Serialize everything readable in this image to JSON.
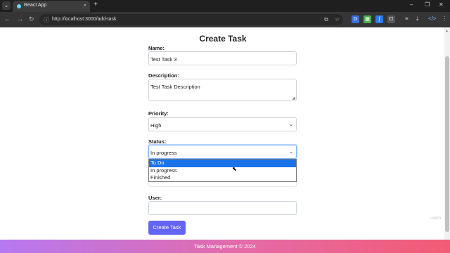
{
  "browser": {
    "tab_title": "React App",
    "url": "http://localhost:3000/add-task"
  },
  "page": {
    "title": "Create Task",
    "fields": {
      "name": {
        "label": "Name:",
        "value": "Test Task 3"
      },
      "description": {
        "label": "Description:",
        "value": "Test Task Description"
      },
      "priority": {
        "label": "Priority:",
        "value": "High"
      },
      "status": {
        "label": "Status:",
        "value": "In progress",
        "options": [
          "To Do",
          "In progress",
          "Finished"
        ],
        "highlighted_option": "To Do"
      },
      "user": {
        "label": "User:",
        "value": ""
      }
    },
    "submit_label": "Create Task",
    "watermark": "udem"
  },
  "footer": {
    "text": "Task Management © 2024"
  },
  "colors": {
    "button": "#6464f5",
    "footer_gradient": [
      "#b678f1",
      "#e56aa7",
      "#f25b72"
    ],
    "selected_option": "#1a73e8"
  }
}
